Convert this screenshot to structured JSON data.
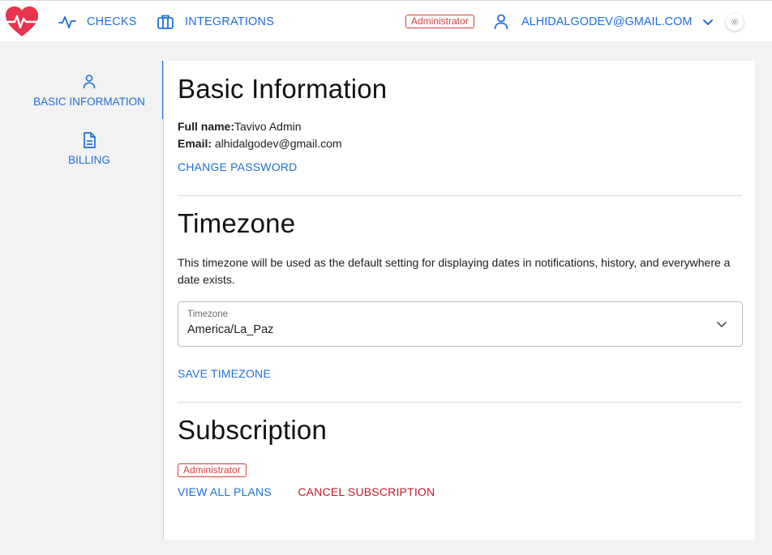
{
  "colors": {
    "accent": "#1e6fd9",
    "danger": "#c0182a",
    "badge": "#d93b3b",
    "logo": "#e8344e"
  },
  "topbar": {
    "nav": [
      {
        "label": "CHECKS",
        "icon": "activity-icon"
      },
      {
        "label": "INTEGRATIONS",
        "icon": "briefcase-icon"
      }
    ],
    "role_badge": "Administrator",
    "user_email": "ALHIDALGODEV@GMAIL.COM"
  },
  "sidebar": {
    "items": [
      {
        "label": "BASIC INFORMATION",
        "icon": "user-icon",
        "active": true
      },
      {
        "label": "BILLING",
        "icon": "document-icon",
        "active": false
      }
    ]
  },
  "basic_info": {
    "title": "Basic Information",
    "full_name_label": "Full name:",
    "full_name": "Tavivo Admin",
    "email_label": "Email:",
    "email": "alhidalgodev@gmail.com",
    "change_password": "CHANGE PASSWORD"
  },
  "timezone": {
    "title": "Timezone",
    "description": "This timezone will be used as the default setting for displaying dates in notifications, history, and everywhere a date exists.",
    "field_label": "Timezone",
    "value": "America/La_Paz",
    "save": "SAVE TIMEZONE"
  },
  "subscription": {
    "title": "Subscription",
    "badge": "Administrator",
    "view_plans": "VIEW ALL PLANS",
    "cancel": "CANCEL SUBSCRIPTION"
  }
}
